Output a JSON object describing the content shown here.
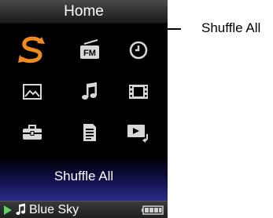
{
  "header": {
    "title": "Home"
  },
  "menu": {
    "items": [
      {
        "icon": "shuffle-all-icon",
        "selected": true
      },
      {
        "icon": "fm-radio-icon",
        "label": "FM"
      },
      {
        "icon": "clock-icon"
      },
      {
        "icon": "photo-icon"
      },
      {
        "icon": "music-note-icon"
      },
      {
        "icon": "video-film-icon"
      },
      {
        "icon": "settings-toolbox-icon"
      },
      {
        "icon": "document-icon"
      },
      {
        "icon": "now-playing-icon"
      }
    ],
    "selected_label": "Shuffle All"
  },
  "status": {
    "track": "Blue Sky",
    "state": "playing"
  },
  "callout": {
    "text": "Shuffle All"
  },
  "colors": {
    "accent": "#f08a1e",
    "play": "#5fd35f",
    "icon": "#d8d8d8"
  }
}
